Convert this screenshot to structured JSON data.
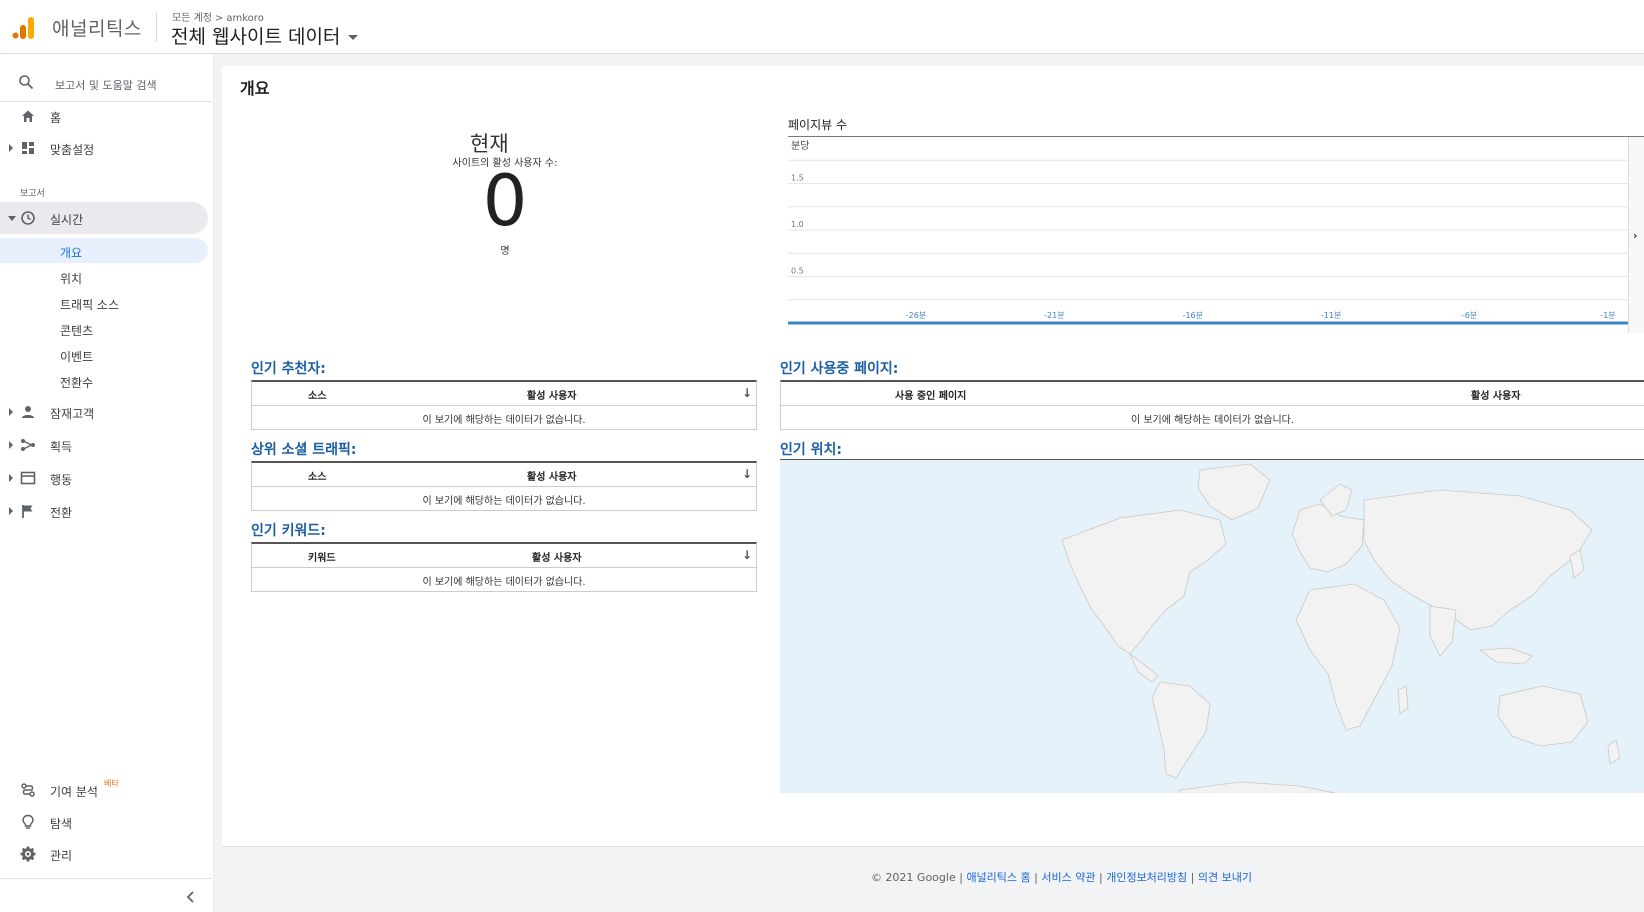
{
  "header": {
    "app_name": "애널리틱스",
    "breadcrumb_root": "모든 계정",
    "breadcrumb_separator": ">",
    "breadcrumb_account": "amkoro",
    "property_title": "전체 웹사이트 데이터"
  },
  "sidebar": {
    "search_placeholder": "보고서 및 도움말 검색",
    "home": "홈",
    "customization": "맞춤설정",
    "reports_section": "보고서",
    "realtime": "실시간",
    "realtime_sub": [
      "개요",
      "위치",
      "트래픽 소스",
      "콘텐츠",
      "이벤트",
      "전환수"
    ],
    "audience": "잠재고객",
    "acquisition": "획득",
    "behavior": "행동",
    "conversions": "전환",
    "attribution": "기여 분석",
    "attribution_badge": "베타",
    "discover": "탐색",
    "admin": "관리",
    "collapse_icon": "chevron-left-icon"
  },
  "main": {
    "page_title": "개요",
    "now_label": "현재",
    "active_users_label": "사이트의 활성 사용자 수:",
    "active_count": "0",
    "unit": "명"
  },
  "chart_data": {
    "type": "line",
    "title": "페이지뷰 수",
    "ylabel": "분당",
    "x_ticks": [
      "-26분",
      "-21분",
      "-16분",
      "-11분",
      "-6분",
      "-1분"
    ],
    "y_ticks": [
      "1.5",
      "1.0",
      "0.5"
    ],
    "series": [
      {
        "values": []
      }
    ],
    "ylim": [
      0,
      2
    ],
    "grid": true
  },
  "widgets": {
    "referrers": {
      "title": "인기 추천자:",
      "col1": "소스",
      "col2": "활성 사용자",
      "empty": "이 보기에 해당하는 데이터가 없습니다."
    },
    "social": {
      "title": "상위 소셜 트래픽:",
      "col1": "소스",
      "col2": "활성 사용자",
      "empty": "이 보기에 해당하는 데이터가 없습니다."
    },
    "keywords": {
      "title": "인기 키워드:",
      "col1": "키워드",
      "col2": "활성 사용자",
      "empty": "이 보기에 해당하는 데이터가 없습니다."
    },
    "pages": {
      "title": "인기 사용중 페이지:",
      "col1": "사용 중인 페이지",
      "col2": "활성 사용자",
      "empty": "이 보기에 해당하는 데이터가 없습니다."
    },
    "locations": {
      "title": "인기 위치:"
    }
  },
  "footer": {
    "copyright": "© 2021 Google",
    "sep": "|",
    "links": [
      "애널리틱스 홈",
      "서비스 약관",
      "개인정보처리방침",
      "의견 보내기"
    ]
  },
  "colors": {
    "accent_blue": "#1a73e8",
    "logo_orange": "#f9ab00",
    "logo_dark_orange": "#e37400",
    "widget_title_blue": "#1a5fa6",
    "chart_axis_blue": "#3d85c6",
    "map_water": "#e6f2fa",
    "map_land": "#f2f2f2"
  }
}
